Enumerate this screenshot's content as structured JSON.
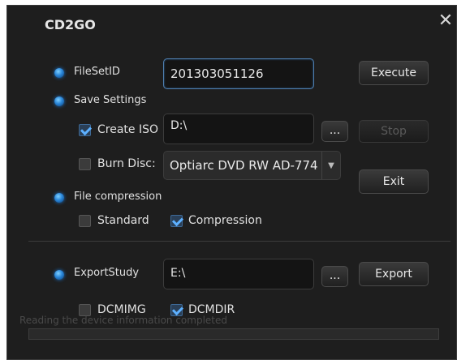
{
  "window": {
    "title": "CD2GO",
    "close_glyph": "✕"
  },
  "fileset": {
    "label": "FileSetID",
    "value": "201303051126",
    "execute_label": "Execute"
  },
  "save_settings": {
    "label": "Save Settings",
    "create_iso": {
      "label": "Create ISO",
      "checked": true,
      "path": "D:\\",
      "browse_label": "...",
      "stop_label": "Stop"
    },
    "burn_disc": {
      "label": "Burn Disc:",
      "checked": false,
      "selected_drive": "Optiarc DVD RW AD-774"
    },
    "exit_label": "Exit"
  },
  "file_compression": {
    "label": "File compression",
    "standard_label": "Standard",
    "standard_checked": false,
    "compression_label": "Compression",
    "compression_checked": true
  },
  "export": {
    "label": "ExportStudy",
    "path": "E:\\",
    "browse_label": "...",
    "export_label": "Export",
    "dcmimg_label": "DCMIMG",
    "dcmimg_checked": false,
    "dcmdir_label": "DCMDIR",
    "dcmdir_checked": true
  },
  "status": {
    "text": "Reading the device information completed",
    "progress": 0
  },
  "colors": {
    "accent": "#2a86d8",
    "background": "#1e1e1e"
  }
}
